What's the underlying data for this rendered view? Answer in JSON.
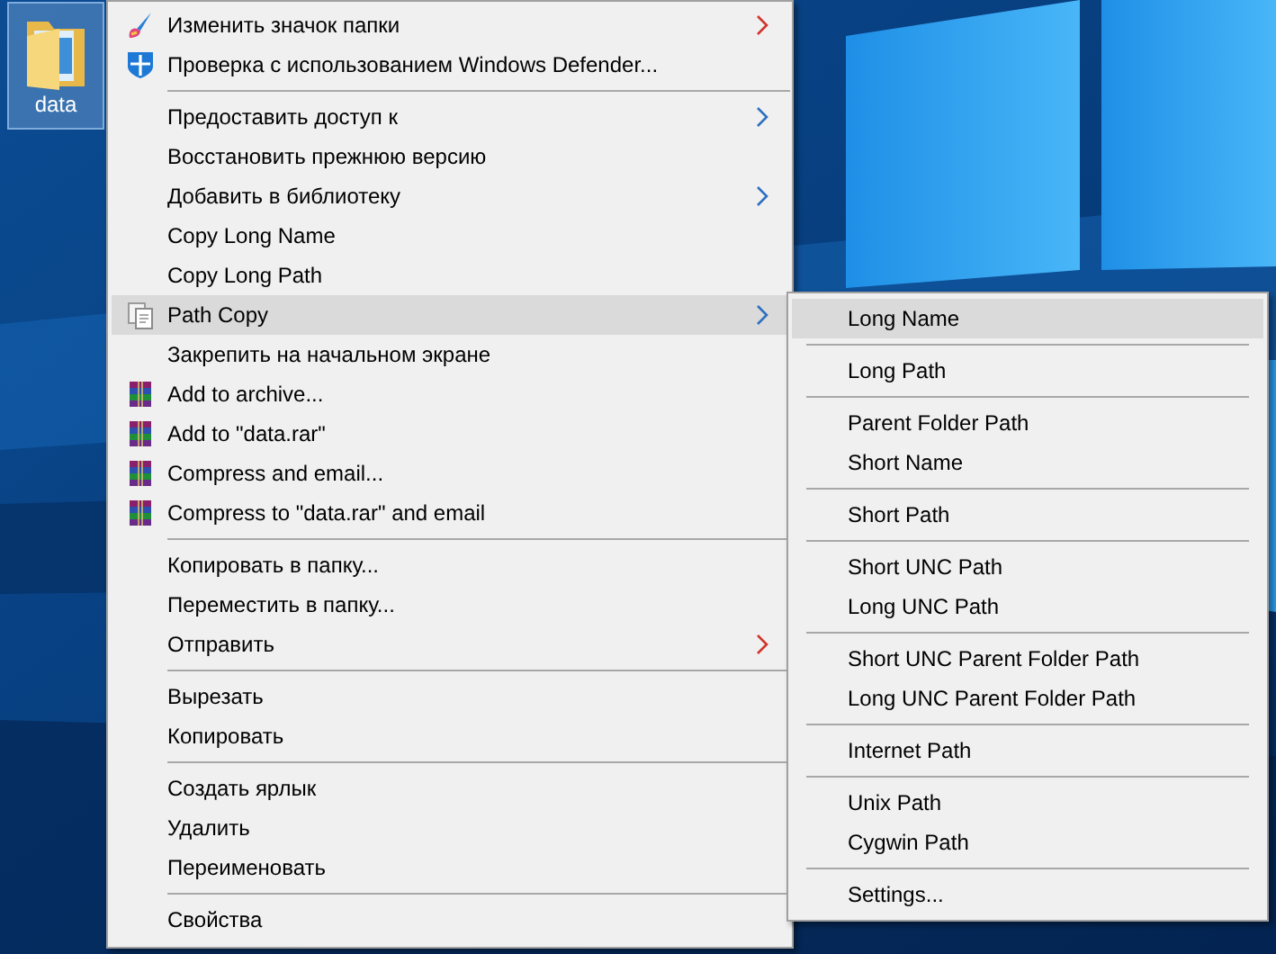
{
  "desktop_icon": {
    "label": "data",
    "selected": true
  },
  "context_menu": {
    "groups": [
      {
        "items": [
          {
            "label": "Изменить значок папки",
            "kind": "brush",
            "submenu": true,
            "color": "#d0342c",
            "selected": false
          },
          {
            "label": "Проверка с использованием Windows Defender...",
            "kind": "shield",
            "submenu": false,
            "selected": false
          }
        ]
      },
      {
        "items": [
          {
            "label": "Предоставить доступ к",
            "kind": "plain",
            "submenu": true,
            "color": "#2f6fc0",
            "selected": false
          },
          {
            "label": "Восстановить прежнюю версию",
            "kind": "plain",
            "submenu": false,
            "selected": false
          },
          {
            "label": "Добавить в библиотеку",
            "kind": "plain",
            "submenu": true,
            "color": "#2f6fc0",
            "selected": false
          },
          {
            "label": "Copy Long Name",
            "kind": "plain",
            "submenu": false,
            "selected": false
          },
          {
            "label": "Copy Long Path",
            "kind": "plain",
            "submenu": false,
            "selected": false
          },
          {
            "label": "Path Copy",
            "kind": "document",
            "submenu": true,
            "color": "#2f6fc0",
            "selected": true
          },
          {
            "label": "Закрепить на начальном экране",
            "kind": "plain",
            "submenu": false,
            "selected": false
          },
          {
            "label": "Add to archive...",
            "kind": "archive",
            "submenu": false,
            "selected": false
          },
          {
            "label": "Add to \"data.rar\"",
            "kind": "archive",
            "submenu": false,
            "selected": false
          },
          {
            "label": "Compress and email...",
            "kind": "archive",
            "submenu": false,
            "selected": false
          },
          {
            "label": "Compress to \"data.rar\" and email",
            "kind": "archive",
            "submenu": false,
            "selected": false
          }
        ]
      },
      {
        "items": [
          {
            "label": "Копировать в папку...",
            "kind": "plain",
            "submenu": false,
            "selected": false
          },
          {
            "label": "Переместить в папку...",
            "kind": "plain",
            "submenu": false,
            "selected": false
          },
          {
            "label": "Отправить",
            "kind": "plain",
            "submenu": true,
            "color": "#d0342c",
            "selected": false
          }
        ]
      },
      {
        "items": [
          {
            "label": "Вырезать",
            "kind": "plain",
            "submenu": false,
            "selected": false
          },
          {
            "label": "Копировать",
            "kind": "plain",
            "submenu": false,
            "selected": false
          }
        ]
      },
      {
        "items": [
          {
            "label": "Создать ярлык",
            "kind": "plain",
            "submenu": false,
            "selected": false
          },
          {
            "label": "Удалить",
            "kind": "plain",
            "submenu": false,
            "selected": false
          },
          {
            "label": "Переименовать",
            "kind": "plain",
            "submenu": false,
            "selected": false
          }
        ]
      },
      {
        "items": [
          {
            "label": "Свойства",
            "kind": "plain",
            "submenu": false,
            "selected": false
          }
        ]
      }
    ]
  },
  "submenu": {
    "groups": [
      {
        "items": [
          {
            "label": "Long Name",
            "selected": true
          }
        ]
      },
      {
        "items": [
          {
            "label": "Long Path",
            "selected": false
          }
        ]
      },
      {
        "items": [
          {
            "label": "Parent Folder Path",
            "selected": false
          },
          {
            "label": "Short Name",
            "selected": false
          }
        ]
      },
      {
        "items": [
          {
            "label": "Short Path",
            "selected": false
          }
        ]
      },
      {
        "items": [
          {
            "label": "Short UNC Path",
            "selected": false
          },
          {
            "label": "Long UNC Path",
            "selected": false
          }
        ]
      },
      {
        "items": [
          {
            "label": "Short UNC Parent Folder Path",
            "selected": false
          },
          {
            "label": "Long UNC Parent Folder Path",
            "selected": false
          }
        ]
      },
      {
        "items": [
          {
            "label": "Internet Path",
            "selected": false
          }
        ]
      },
      {
        "items": [
          {
            "label": "Unix Path",
            "selected": false
          },
          {
            "label": "Cygwin Path",
            "selected": false
          }
        ]
      },
      {
        "items": [
          {
            "label": "Settings...",
            "selected": false
          }
        ]
      }
    ]
  }
}
